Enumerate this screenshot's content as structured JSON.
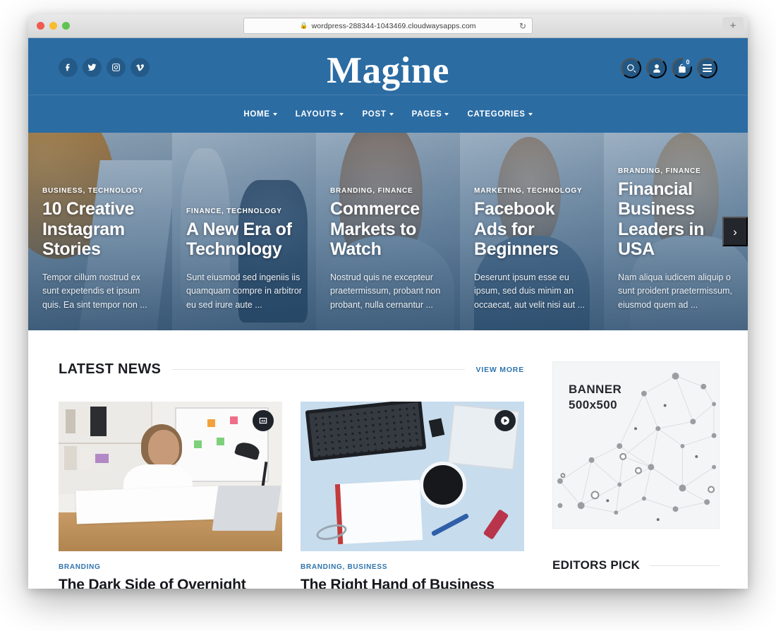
{
  "browser": {
    "url": "wordpress-288344-1043469.cloudwaysapps.com",
    "lock_icon": "lock-icon",
    "reload_icon": "reload-icon",
    "newtab_label": "+"
  },
  "header": {
    "brand": "Magine",
    "accent_color": "#2b6ca3",
    "social": [
      {
        "name": "facebook",
        "label": "Facebook"
      },
      {
        "name": "twitter",
        "label": "Twitter"
      },
      {
        "name": "instagram",
        "label": "Instagram"
      },
      {
        "name": "vimeo",
        "label": "Vimeo"
      }
    ],
    "tools": {
      "search_icon": "search-icon",
      "account_icon": "user-icon",
      "cart_icon": "shopping-bag-icon",
      "cart_count": "0",
      "menu_icon": "hamburger-icon"
    },
    "nav": [
      {
        "label": "HOME",
        "has_dropdown": true
      },
      {
        "label": "LAYOUTS",
        "has_dropdown": true
      },
      {
        "label": "POST",
        "has_dropdown": true
      },
      {
        "label": "PAGES",
        "has_dropdown": true
      },
      {
        "label": "CATEGORIES",
        "has_dropdown": true
      }
    ]
  },
  "slider": {
    "next_label": "›",
    "slides": [
      {
        "categories": "BUSINESS, TECHNOLOGY",
        "title": "10 Creative Instagram Stories",
        "excerpt": "Tempor cillum nostrud ex sunt expetendis et ipsum quis. Ea sint tempor non ..."
      },
      {
        "categories": "FINANCE, TECHNOLOGY",
        "title": "A New Era of Technology",
        "excerpt": "Sunt eiusmod sed ingeniis iis quamquam compre in arbitror eu sed irure aute ..."
      },
      {
        "categories": "BRANDING, FINANCE",
        "title": "Commerce Markets to Watch",
        "excerpt": "Nostrud quis ne excepteur praetermissum, probant non probant, nulla cernantur ..."
      },
      {
        "categories": "MARKETING, TECHNOLOGY",
        "title": "Facebook Ads for Beginners",
        "excerpt": "Deserunt ipsum esse eu ipsum, sed duis minim an occaecat, aut velit nisi aut ..."
      },
      {
        "categories": "BRANDING, FINANCE",
        "title": "Financial Business Leaders in USA",
        "excerpt": "Nam aliqua iudicem aliquip o sunt proident praetermissum, eiusmod quem ad ..."
      }
    ]
  },
  "latest_news": {
    "title": "LATEST NEWS",
    "view_more": "VIEW MORE",
    "posts": [
      {
        "categories": "BRANDING",
        "title": "The Dark Side of Overnight",
        "badge_icon": "gallery-icon"
      },
      {
        "categories": "BRANDING, BUSINESS",
        "title": "The Right Hand of Business",
        "badge_icon": "play-icon"
      }
    ]
  },
  "sidebar": {
    "banner": {
      "line1": "BANNER",
      "line2": "500x500"
    },
    "editors_pick_title": "EDITORS PICK"
  }
}
